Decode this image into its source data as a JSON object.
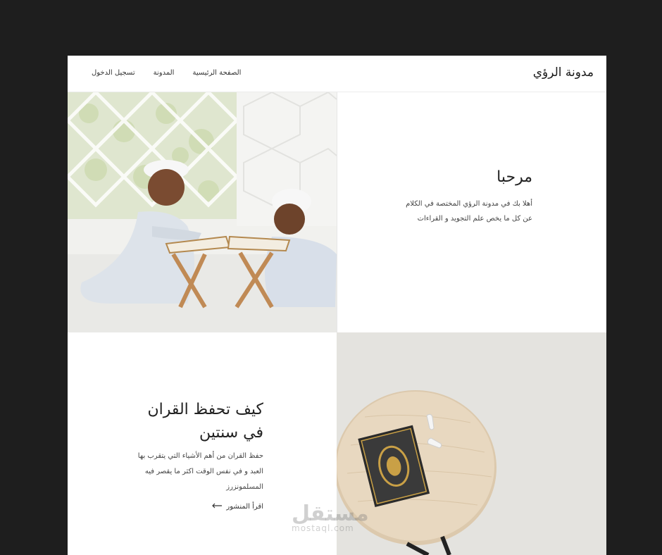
{
  "header": {
    "brand": "مدونة الرؤي",
    "nav": [
      {
        "label": "الصفحة الرئيسية"
      },
      {
        "label": "المدونة"
      },
      {
        "label": "تسجيل الدخول"
      }
    ]
  },
  "hero": {
    "title": "مرحبا",
    "description": "أهلا بك في مدونة الرؤي المختصة في الكلام عن كل ما يخص علم التجويد و القراءات",
    "image_icon": "kids-reading-quran-image"
  },
  "post": {
    "title": "كيف تحفظ القران في سنتين",
    "description": "حفظ القران من أهم الأشياء التي يتقرب بها العبد و في نفس الوقت اكثر ما يقصر فيه المسلمونزرز",
    "read_more": "اقرأ المنشور",
    "image_icon": "quran-on-table-image"
  },
  "watermark": {
    "arabic": "مستقل",
    "latin": "mostaql.com"
  },
  "colors": {
    "background": "#1e1e1e",
    "page": "#ffffff",
    "text": "#222222"
  }
}
